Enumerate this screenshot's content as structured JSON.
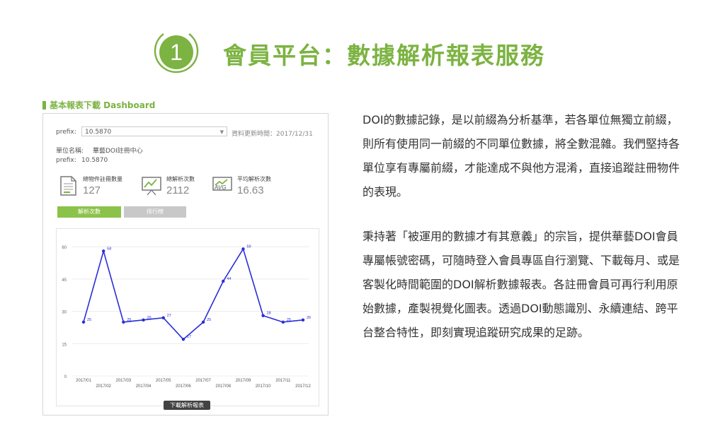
{
  "header": {
    "number": "1",
    "title": "會員平台：數據解析報表服務"
  },
  "colors": {
    "accent": "#7cb342",
    "line": "#2a2ed6",
    "tab_active": "#8bc34a",
    "tab_inactive": "#c8c8c8"
  },
  "dashboard": {
    "caption": "基本報表下載 Dashboard",
    "prefix_label": "prefix:",
    "prefix_value": "10.5870",
    "updated_text": "資料更新時間：2017/12/31",
    "unit_label": "單位名稱:",
    "unit_value": "華藝DOI註冊中心",
    "prefix2_label": "prefix:",
    "prefix2_value": "10.5870",
    "stats": [
      {
        "label": "總物件註冊數量",
        "value": "127",
        "icon": "document-icon"
      },
      {
        "label": "總解析次數",
        "value": "2112",
        "icon": "chart-monitor-icon"
      },
      {
        "label": "平均解析次數",
        "value": "16.63",
        "icon": "avg-monitor-icon"
      }
    ],
    "tabs": [
      "解析次數",
      "排行榜"
    ],
    "download_label": "下載解析報表"
  },
  "chart_data": {
    "type": "line",
    "categories": [
      "2017/01",
      "2017/02",
      "2017/03",
      "2017/04",
      "2017/05",
      "2017/06",
      "2017/07",
      "2017/08",
      "2017/09",
      "2017/10",
      "2017/11",
      "2017/12"
    ],
    "series": [
      {
        "values": [
          25,
          58,
          25,
          26,
          27,
          17,
          25,
          44,
          59,
          28,
          25,
          26
        ]
      }
    ],
    "yticks": [
      0,
      15,
      30,
      45,
      60
    ],
    "ylim": [
      0,
      65
    ],
    "grid": true,
    "title": "",
    "xlabel": "",
    "ylabel": ""
  },
  "text": {
    "p1": "DOI的數據記錄，是以前綴為分析基準，若各單位無獨立前綴，則所有使用同一前綴的不同單位數據，將全數混雜。我們堅持各單位享有專屬前綴，才能達成不與他方混淆，直接追蹤註冊物件的表現。",
    "p2": "秉持著「被運用的數據才有其意義」的宗旨，提供華藝DOI會員專屬帳號密碼，可隨時登入會員專區自行瀏覽、下載每月、或是客製化時間範圍的DOI解析數據報表。各註冊會員可再行利用原始數據，產製視覺化圖表。透過DOI動態識別、永續連結、跨平台整合特性，即刻實現追蹤研究成果的足跡。"
  }
}
